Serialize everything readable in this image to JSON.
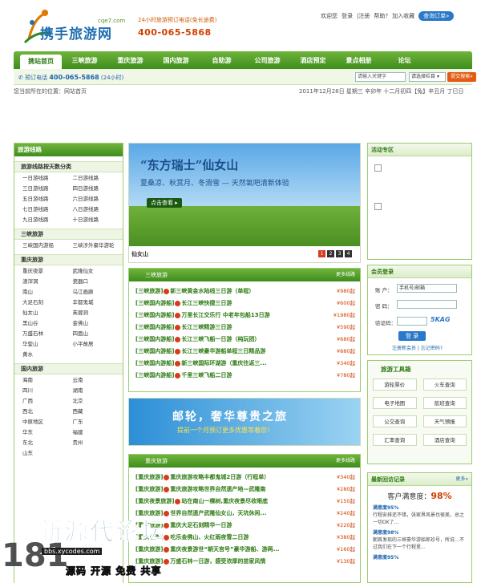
{
  "header": {
    "brand": "携手旅游网",
    "domain": "cqe7.com",
    "hotline_label": "24小时旅游预订电话(免长途费)",
    "hotline_24": "24小时",
    "hotline_number": "400-065-5868",
    "top_links": [
      "欢迎您",
      "登录",
      "|注册",
      "帮助?",
      "加入收藏"
    ],
    "book_button": "查询订单»"
  },
  "nav": {
    "items": [
      "携站首页",
      "三峡旅游",
      "重庆旅游",
      "国内旅游",
      "自助游",
      "公司旅游",
      "酒店预定",
      "景点相册",
      "论坛"
    ]
  },
  "subbar": {
    "tel_label": "预订电话",
    "tel_number": "400-065-5868",
    "tel_suffix": "(24小时)",
    "keyword_placeholder": "请输入关键字",
    "select_label": "请选择栏目",
    "search_button": "提交搜索»"
  },
  "breadcrumb": "您当前所在的位置：网站首页",
  "date": "2011年12月28日 星期三 辛卯年 十二月初四【兔】辛丑月 丁巳日",
  "left": {
    "title": "旅游线路",
    "sections": [
      {
        "title": "旅游线路按天数分类",
        "items": [
          "一日游线路",
          "二日游线路",
          "三日游线路",
          "四日游线路",
          "五日游线路",
          "六日游线路",
          "七日游线路",
          "八日游线路",
          "九日游线路",
          "十日游线路"
        ]
      },
      {
        "title": "三峡旅游",
        "items": [
          "三峡国内游船",
          "三峡涉外豪华游轮"
        ]
      },
      {
        "title": "重庆旅游",
        "items": [
          "重庆夜景",
          "武隆仙女",
          "渣滓洞",
          "瓷器口",
          "南山",
          "乌江画廊",
          "大足石刻",
          "丰都鬼城",
          "仙女山",
          "芙蓉洞",
          "黑山谷",
          "金佛山",
          "万盛石林",
          "四面山",
          "华蓥山",
          "小平故居",
          "黄水"
        ]
      },
      {
        "title": "国内旅游",
        "items": [
          "海南",
          "云南",
          "四川",
          "湖南",
          "广西",
          "北京",
          "西北",
          "西藏",
          "中原地区",
          "广东",
          "华东",
          "福建",
          "东北",
          "贵州",
          "山东"
        ]
      }
    ]
  },
  "banner": {
    "title": "“东方瑞士”仙女山",
    "subtitle": "夏桑凉、秋赏月、冬滑雪  —  天然氧吧清新体验",
    "more": "点击查看 ▸",
    "caption": "仙女山",
    "pages": [
      "1",
      "2",
      "3",
      "4"
    ]
  },
  "sanxia": {
    "title": "三峡旅游",
    "more": "更多线路",
    "rows": [
      {
        "cat": "[三峡旅游]",
        "title": "新三峡黄金水陆线三日游（单程）",
        "price": "¥980起"
      },
      {
        "cat": "[三峡国内游船]",
        "title": "长江三峡快捷三日游",
        "price": "¥600起"
      },
      {
        "cat": "[三峡国内游船]",
        "title": "万里长江交乐行 中老年包船13日游",
        "price": "¥1980起"
      },
      {
        "cat": "[三峡国内游船]",
        "title": "长江三峡精游三日游",
        "price": "¥590起"
      },
      {
        "cat": "[三峡国内游船]",
        "title": "长江三峡飞船一日游（纯玩团）",
        "price": "¥680起"
      },
      {
        "cat": "[三峡国内游船]",
        "title": "长江三峡豪华游船单程三日精品游",
        "price": "¥880起"
      },
      {
        "cat": "[三峡国内游船]",
        "title": "新三峡国际环湖游（重庆往返三...",
        "price": "¥340起"
      },
      {
        "cat": "[三峡国内游船]",
        "title": "千里三峡飞船二日游",
        "price": "¥780起"
      }
    ]
  },
  "promo": {
    "title": "邮轮，奢华尊贵之旅",
    "subtitle": "提前一个月预订更多优惠等着您！"
  },
  "chongqing": {
    "title": "重庆旅游",
    "more": "更多线路",
    "rows": [
      {
        "cat": "[重庆旅游]",
        "title": "重庆旅游攻略丰都鬼城2日游（行程单）",
        "price": "¥340起"
      },
      {
        "cat": "[重庆旅游]",
        "title": "重庆旅游攻略世界自然遗产地—武隆南",
        "price": "¥280起"
      },
      {
        "cat": "[重庆夜景旅游]",
        "title": "站在南山一棵树,重庆夜景尽收眼底",
        "price": "¥150起"
      },
      {
        "cat": "[重庆旅游]",
        "title": "世界自然遗产武隆仙女山，天坑休闲...",
        "price": "¥240起"
      },
      {
        "cat": "[重庆旅游]",
        "title": "重庆大足石刻精华一日游",
        "price": "¥220起"
      },
      {
        "cat": "[重庆旅游]",
        "title": "吃乐金佛山、火红雨夜雪二日游",
        "price": "¥380起"
      },
      {
        "cat": "[重庆旅游]",
        "title": "重庆夜景游世“朝天宫号”豪华游船、游两...",
        "price": "¥160起"
      },
      {
        "cat": "[重庆旅游]",
        "title": "万盛石林一日游，感受浓厚的苗家风情",
        "price": "¥130起"
      }
    ]
  },
  "activity": {
    "title": "活动专区"
  },
  "member": {
    "title": "会员登录",
    "account_label": "账  户：",
    "account_value": "手机号/邮箱",
    "password_label": "密  码：",
    "captcha_label": "验证码：",
    "captcha": "5KAG",
    "login": "登 录",
    "register": "注册新会员",
    "forgot": "忘记密码?"
  },
  "tools": {
    "title": "旅游工具箱",
    "items": [
      "游轮票价",
      "火车查询",
      "电子地图",
      "航班查询",
      "公交查询",
      "天气预报",
      "汇率查询",
      "酒店查询"
    ]
  },
  "reviews": {
    "title": "最新回访记录",
    "more": "更多»",
    "satisfaction_label": "客户满意度：",
    "satisfaction": "98%",
    "items": [
      {
        "score": "满意度95%",
        "text": "行程安排还不错，张家界风景也很美，总之一切OK了..."
      },
      {
        "score": "满意度98%",
        "text": "朝首发现的三峡豪华游船郎珍号，所说…不过我们在下一个行程里..."
      },
      {
        "score": "满意度95%",
        "text": ""
      }
    ]
  },
  "watermark": {
    "main": "新源代论坛",
    "url": "bbs.xycodes.com",
    "sub": "源码 开源 免费 共享",
    "num": "181"
  }
}
